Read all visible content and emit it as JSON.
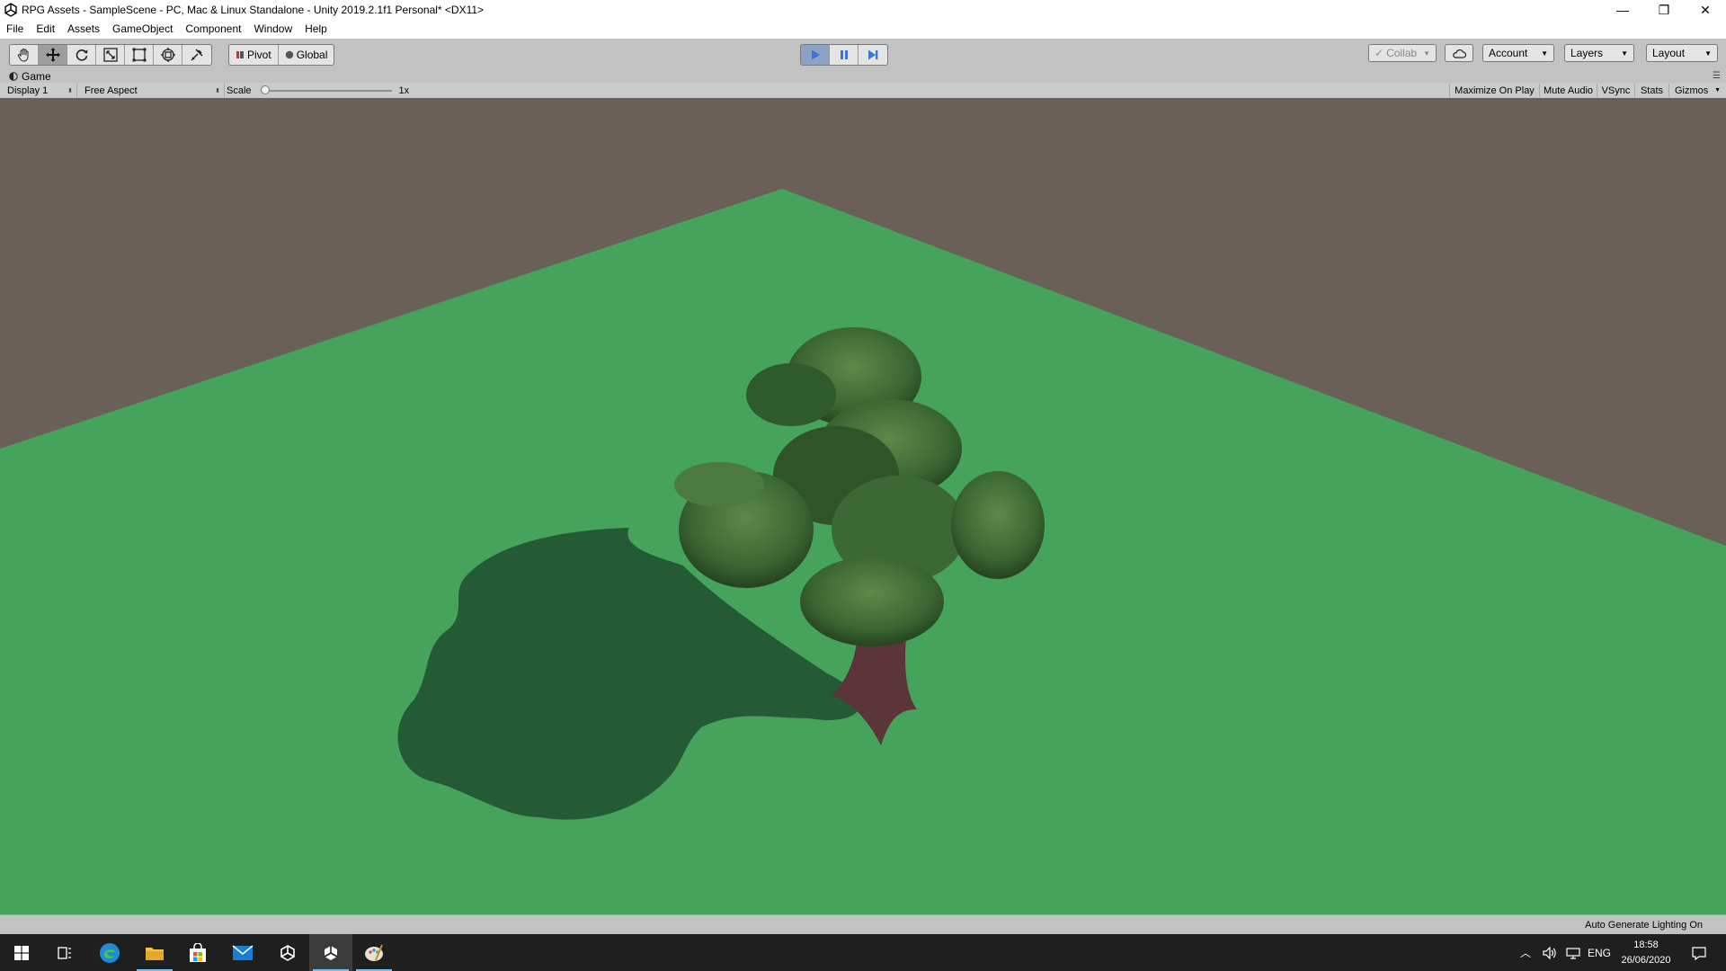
{
  "window": {
    "title": "RPG Assets - SampleScene - PC, Mac & Linux Standalone - Unity 2019.2.1f1 Personal* <DX11>",
    "controls": {
      "minimize": "—",
      "restore": "❐",
      "close": "✕"
    }
  },
  "menu": {
    "items": [
      "File",
      "Edit",
      "Assets",
      "GameObject",
      "Component",
      "Window",
      "Help"
    ]
  },
  "toolbar": {
    "tools": [
      "hand-tool",
      "move-tool",
      "rotate-tool",
      "scale-tool",
      "rect-tool",
      "transform-tool",
      "custom-tool"
    ],
    "active_tool": "move-tool",
    "pivot_label": "Pivot",
    "global_label": "Global",
    "play_state": "playing",
    "collab_label": "Collab",
    "account_label": "Account",
    "layers_label": "Layers",
    "layout_label": "Layout"
  },
  "game_tab": {
    "label": "Game"
  },
  "game_toolbar": {
    "display": "Display 1",
    "aspect": "Free Aspect",
    "scale_label": "Scale",
    "scale_value": "1x",
    "scale_slider_level": 0,
    "maximize_on_play": "Maximize On Play",
    "mute_audio": "Mute Audio",
    "vsync": "VSync",
    "stats": "Stats",
    "gizmos": "Gizmos"
  },
  "status": {
    "message": "Auto Generate Lighting On"
  },
  "taskbar": {
    "apps": [
      "windows-start-icon",
      "task-view-icon",
      "edge-icon",
      "file-explorer-icon",
      "store-icon",
      "mail-icon",
      "unity-hub-icon",
      "unity-editor-icon",
      "paint-icon"
    ],
    "tray": {
      "language": "ENG",
      "time": "18:58",
      "date": "26/06/2020"
    }
  },
  "colors": {
    "ground": "#45a35b",
    "sky": "#6a5f59",
    "shadow": "#245a34",
    "foliage": "#3d6b34",
    "trunk": "#5b3539",
    "play_accent": "#3a78d4"
  }
}
